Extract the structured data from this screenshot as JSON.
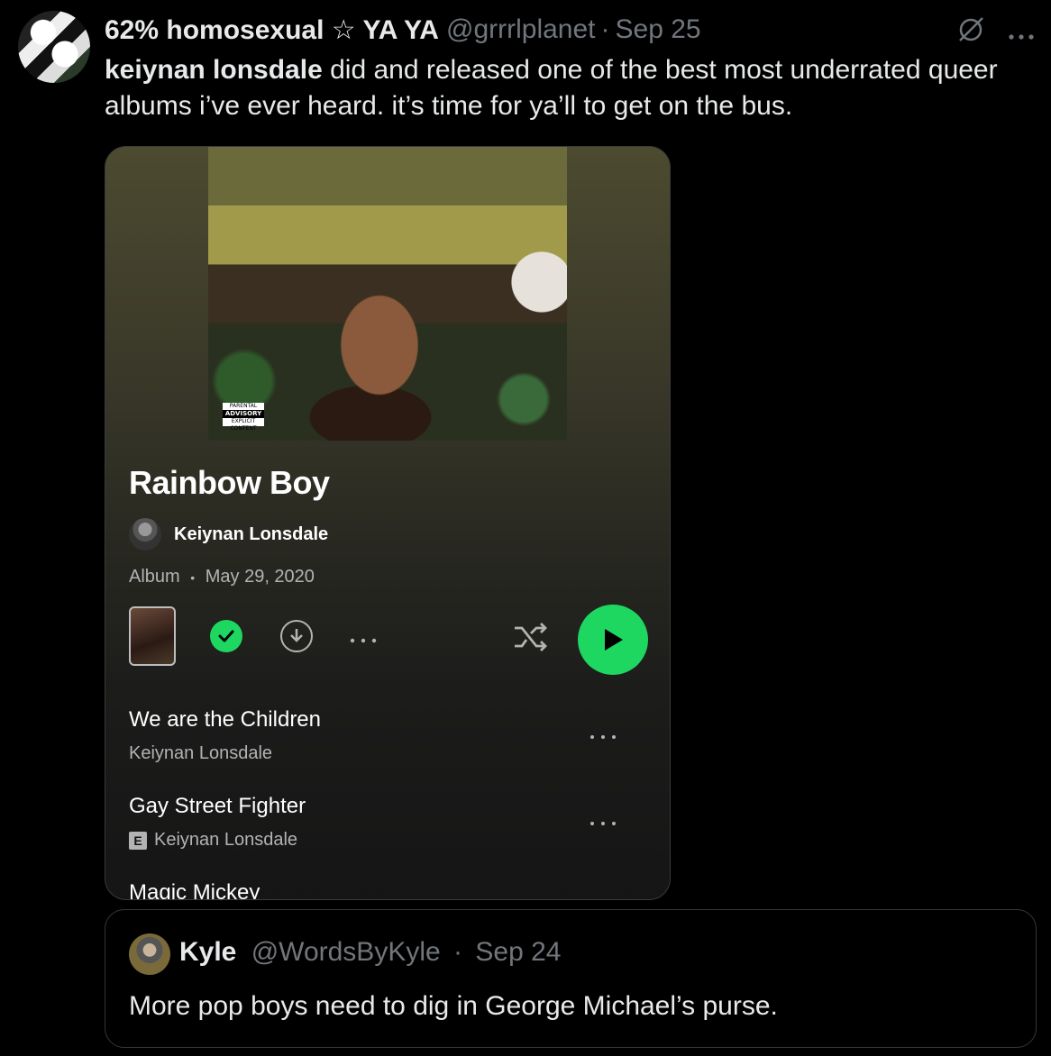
{
  "tweet": {
    "display_name": "62% homosexual ☆ YA YA",
    "handle": "@grrrlplanet",
    "separator": "·",
    "time": "Sep 25",
    "text_bold": "keiynan lonsdale",
    "text_rest": " did and released one of the best most underrated queer albums i’ve ever heard. it’s time for ya’ll to get on the bus."
  },
  "album": {
    "title": "Rainbow Boy",
    "artist": "Keiynan Lonsdale",
    "type": "Album",
    "meta_separator": "•",
    "release_date": "May 29, 2020",
    "advisory_top": "PARENTAL",
    "advisory_main": "ADVISORY",
    "advisory_bottom": "EXPLICIT CONTENT",
    "saved_color": "#1ed760"
  },
  "tracks": [
    {
      "title": "We are the Children",
      "artist": "Keiynan Lonsdale",
      "explicit": false
    },
    {
      "title": "Gay Street Fighter",
      "artist": "Keiynan Lonsdale",
      "explicit": true,
      "badge": "E"
    },
    {
      "title": "Magic Mickey"
    }
  ],
  "quote": {
    "name": "Kyle",
    "handle": "@WordsByKyle",
    "separator": "·",
    "time": "Sep 24",
    "text": "More pop boys need to dig in George Michael’s purse."
  },
  "icons": [
    "grok-icon",
    "more-options-icon",
    "saved-check-icon",
    "download-icon",
    "shuffle-icon",
    "play-icon"
  ]
}
